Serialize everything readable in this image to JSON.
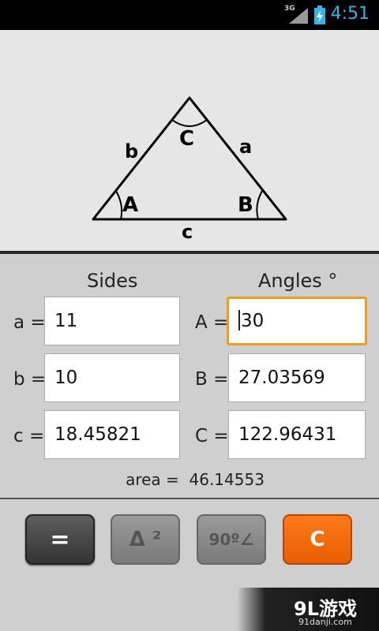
{
  "status_bar": {
    "network": "3G",
    "time": "4:51"
  },
  "triangle": {
    "side_a": "a",
    "side_b": "b",
    "side_c": "c",
    "angle_a": "A",
    "angle_b": "B",
    "angle_c": "C"
  },
  "headers": {
    "sides": "Sides",
    "angles": "Angles °"
  },
  "fields": {
    "a_label": "a =",
    "a_value": "11",
    "b_label": "b =",
    "b_value": "10",
    "c_label": "c =",
    "c_value": "18.45821",
    "A_label": "A =",
    "A_value": "30",
    "B_label": "B =",
    "B_value": "27.03569",
    "C_label": "C =",
    "C_value": "122.96431"
  },
  "area": {
    "label": "area =",
    "value": "46.14553"
  },
  "buttons": {
    "calculate": "=",
    "delta_squared": "Δ ²",
    "right_angle": "90º∠",
    "clear": "C"
  },
  "watermark": {
    "brand": "9L游戏",
    "site": "91danji.com"
  },
  "colors": {
    "accent_orange": "#ff6600",
    "focus_border": "#f39a1d",
    "clock_blue": "#34b5e5"
  }
}
